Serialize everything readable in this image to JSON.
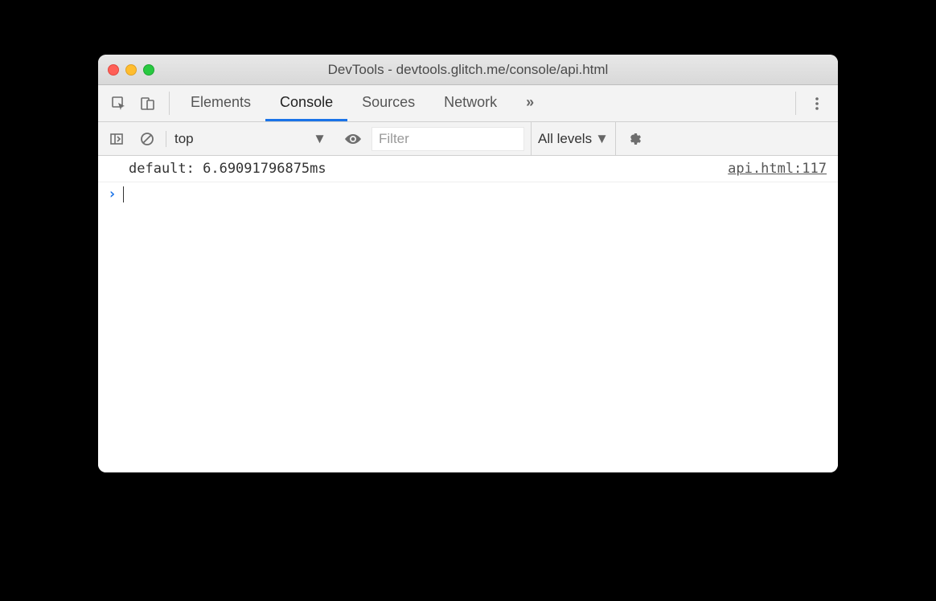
{
  "window": {
    "title": "DevTools - devtools.glitch.me/console/api.html"
  },
  "tabs": {
    "elements": "Elements",
    "console": "Console",
    "sources": "Sources",
    "network": "Network"
  },
  "toolbar": {
    "context": "top",
    "filter_placeholder": "Filter",
    "levels": "All levels"
  },
  "console": {
    "log": "default: 6.69091796875ms",
    "source": "api.html:117"
  }
}
